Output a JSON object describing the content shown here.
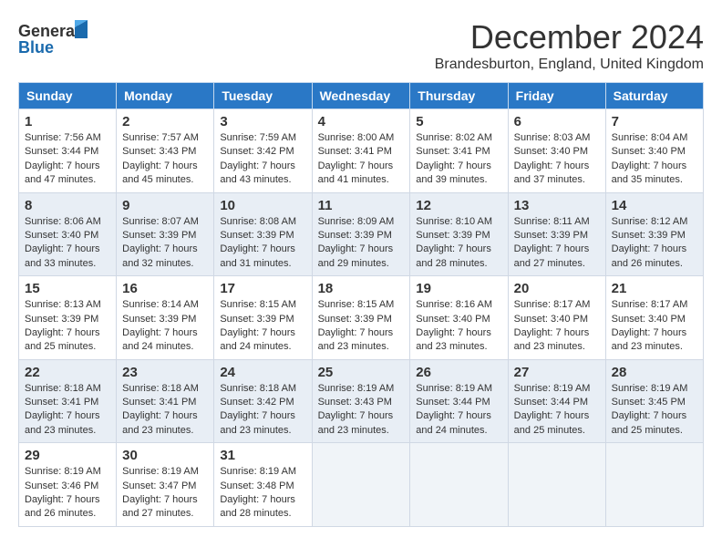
{
  "header": {
    "logo_line1": "General",
    "logo_line2": "Blue",
    "month": "December 2024",
    "location": "Brandesburton, England, United Kingdom"
  },
  "days_of_week": [
    "Sunday",
    "Monday",
    "Tuesday",
    "Wednesday",
    "Thursday",
    "Friday",
    "Saturday"
  ],
  "weeks": [
    [
      {
        "day": "1",
        "sunrise": "7:56 AM",
        "sunset": "3:44 PM",
        "daylight": "7 hours and 47 minutes."
      },
      {
        "day": "2",
        "sunrise": "7:57 AM",
        "sunset": "3:43 PM",
        "daylight": "7 hours and 45 minutes."
      },
      {
        "day": "3",
        "sunrise": "7:59 AM",
        "sunset": "3:42 PM",
        "daylight": "7 hours and 43 minutes."
      },
      {
        "day": "4",
        "sunrise": "8:00 AM",
        "sunset": "3:41 PM",
        "daylight": "7 hours and 41 minutes."
      },
      {
        "day": "5",
        "sunrise": "8:02 AM",
        "sunset": "3:41 PM",
        "daylight": "7 hours and 39 minutes."
      },
      {
        "day": "6",
        "sunrise": "8:03 AM",
        "sunset": "3:40 PM",
        "daylight": "7 hours and 37 minutes."
      },
      {
        "day": "7",
        "sunrise": "8:04 AM",
        "sunset": "3:40 PM",
        "daylight": "7 hours and 35 minutes."
      }
    ],
    [
      {
        "day": "8",
        "sunrise": "8:06 AM",
        "sunset": "3:40 PM",
        "daylight": "7 hours and 33 minutes."
      },
      {
        "day": "9",
        "sunrise": "8:07 AM",
        "sunset": "3:39 PM",
        "daylight": "7 hours and 32 minutes."
      },
      {
        "day": "10",
        "sunrise": "8:08 AM",
        "sunset": "3:39 PM",
        "daylight": "7 hours and 31 minutes."
      },
      {
        "day": "11",
        "sunrise": "8:09 AM",
        "sunset": "3:39 PM",
        "daylight": "7 hours and 29 minutes."
      },
      {
        "day": "12",
        "sunrise": "8:10 AM",
        "sunset": "3:39 PM",
        "daylight": "7 hours and 28 minutes."
      },
      {
        "day": "13",
        "sunrise": "8:11 AM",
        "sunset": "3:39 PM",
        "daylight": "7 hours and 27 minutes."
      },
      {
        "day": "14",
        "sunrise": "8:12 AM",
        "sunset": "3:39 PM",
        "daylight": "7 hours and 26 minutes."
      }
    ],
    [
      {
        "day": "15",
        "sunrise": "8:13 AM",
        "sunset": "3:39 PM",
        "daylight": "7 hours and 25 minutes."
      },
      {
        "day": "16",
        "sunrise": "8:14 AM",
        "sunset": "3:39 PM",
        "daylight": "7 hours and 24 minutes."
      },
      {
        "day": "17",
        "sunrise": "8:15 AM",
        "sunset": "3:39 PM",
        "daylight": "7 hours and 24 minutes."
      },
      {
        "day": "18",
        "sunrise": "8:15 AM",
        "sunset": "3:39 PM",
        "daylight": "7 hours and 23 minutes."
      },
      {
        "day": "19",
        "sunrise": "8:16 AM",
        "sunset": "3:40 PM",
        "daylight": "7 hours and 23 minutes."
      },
      {
        "day": "20",
        "sunrise": "8:17 AM",
        "sunset": "3:40 PM",
        "daylight": "7 hours and 23 minutes."
      },
      {
        "day": "21",
        "sunrise": "8:17 AM",
        "sunset": "3:40 PM",
        "daylight": "7 hours and 23 minutes."
      }
    ],
    [
      {
        "day": "22",
        "sunrise": "8:18 AM",
        "sunset": "3:41 PM",
        "daylight": "7 hours and 23 minutes."
      },
      {
        "day": "23",
        "sunrise": "8:18 AM",
        "sunset": "3:41 PM",
        "daylight": "7 hours and 23 minutes."
      },
      {
        "day": "24",
        "sunrise": "8:18 AM",
        "sunset": "3:42 PM",
        "daylight": "7 hours and 23 minutes."
      },
      {
        "day": "25",
        "sunrise": "8:19 AM",
        "sunset": "3:43 PM",
        "daylight": "7 hours and 23 minutes."
      },
      {
        "day": "26",
        "sunrise": "8:19 AM",
        "sunset": "3:44 PM",
        "daylight": "7 hours and 24 minutes."
      },
      {
        "day": "27",
        "sunrise": "8:19 AM",
        "sunset": "3:44 PM",
        "daylight": "7 hours and 25 minutes."
      },
      {
        "day": "28",
        "sunrise": "8:19 AM",
        "sunset": "3:45 PM",
        "daylight": "7 hours and 25 minutes."
      }
    ],
    [
      {
        "day": "29",
        "sunrise": "8:19 AM",
        "sunset": "3:46 PM",
        "daylight": "7 hours and 26 minutes."
      },
      {
        "day": "30",
        "sunrise": "8:19 AM",
        "sunset": "3:47 PM",
        "daylight": "7 hours and 27 minutes."
      },
      {
        "day": "31",
        "sunrise": "8:19 AM",
        "sunset": "3:48 PM",
        "daylight": "7 hours and 28 minutes."
      },
      null,
      null,
      null,
      null
    ]
  ],
  "labels": {
    "sunrise": "Sunrise:",
    "sunset": "Sunset:",
    "daylight": "Daylight:"
  }
}
